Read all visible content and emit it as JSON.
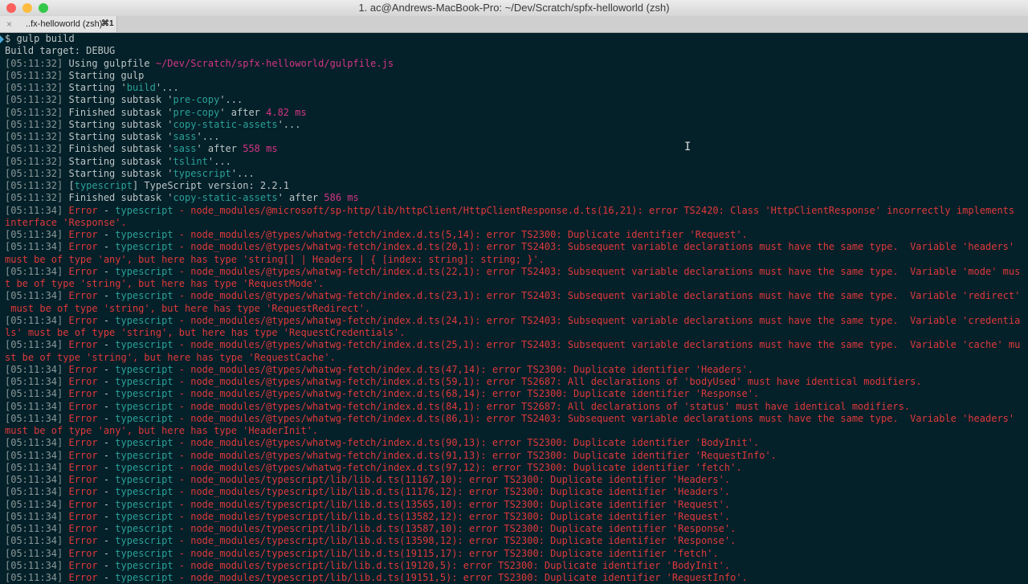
{
  "window": {
    "title": "1. ac@Andrews-MacBook-Pro: ~/Dev/Scratch/spfx-helloworld (zsh)",
    "colors": {
      "close": "#fc605c",
      "minimize": "#fdbc40",
      "zoom": "#34c84a"
    }
  },
  "tab": {
    "label": "..fx-helloworld (zsh)",
    "shortcut": "⌘1",
    "close_icon": "×"
  },
  "cursor_glyph": "I",
  "lines": [
    [
      [
        "tx",
        "$ gulp build"
      ]
    ],
    [
      [
        "tx",
        "Build target: DEBUG"
      ]
    ],
    [
      [
        "ts",
        "[05:11:32] "
      ],
      [
        "tx",
        "Using gulpfile "
      ],
      [
        "m",
        "~/Dev/Scratch/spfx-helloworld/gulpfile.js"
      ]
    ],
    [
      [
        "ts",
        "[05:11:32] "
      ],
      [
        "tx",
        "Starting gulp"
      ]
    ],
    [
      [
        "ts",
        "[05:11:32] "
      ],
      [
        "tx",
        "Starting '"
      ],
      [
        "q",
        "build"
      ],
      [
        "tx",
        "'..."
      ]
    ],
    [
      [
        "ts",
        "[05:11:32] "
      ],
      [
        "tx",
        "Starting subtask '"
      ],
      [
        "q",
        "pre-copy"
      ],
      [
        "tx",
        "'..."
      ]
    ],
    [
      [
        "ts",
        "[05:11:32] "
      ],
      [
        "tx",
        "Finished subtask '"
      ],
      [
        "q",
        "pre-copy"
      ],
      [
        "tx",
        "' after "
      ],
      [
        "m",
        "4.82 ms"
      ]
    ],
    [
      [
        "ts",
        "[05:11:32] "
      ],
      [
        "tx",
        "Starting subtask '"
      ],
      [
        "q",
        "copy-static-assets"
      ],
      [
        "tx",
        "'..."
      ]
    ],
    [
      [
        "ts",
        "[05:11:32] "
      ],
      [
        "tx",
        "Starting subtask '"
      ],
      [
        "q",
        "sass"
      ],
      [
        "tx",
        "'..."
      ]
    ],
    [
      [
        "ts",
        "[05:11:32] "
      ],
      [
        "tx",
        "Finished subtask '"
      ],
      [
        "q",
        "sass"
      ],
      [
        "tx",
        "' after "
      ],
      [
        "m",
        "558 ms"
      ]
    ],
    [
      [
        "ts",
        "[05:11:32] "
      ],
      [
        "tx",
        "Starting subtask '"
      ],
      [
        "q",
        "tslint"
      ],
      [
        "tx",
        "'..."
      ]
    ],
    [
      [
        "ts",
        "[05:11:32] "
      ],
      [
        "tx",
        "Starting subtask '"
      ],
      [
        "q",
        "typescript"
      ],
      [
        "tx",
        "'..."
      ]
    ],
    [
      [
        "ts",
        "[05:11:32] "
      ],
      [
        "tx",
        "["
      ],
      [
        "q",
        "typescript"
      ],
      [
        "tx",
        "] TypeScript version: 2.2.1"
      ]
    ],
    [
      [
        "ts",
        "[05:11:32] "
      ],
      [
        "tx",
        "Finished subtask '"
      ],
      [
        "q",
        "copy-static-assets"
      ],
      [
        "tx",
        "' after "
      ],
      [
        "m",
        "586 ms"
      ]
    ],
    [
      [
        "ts",
        "[05:11:34] "
      ],
      [
        "r",
        "Error"
      ],
      [
        "tx",
        " - "
      ],
      [
        "c",
        "typescript"
      ],
      [
        "r",
        " - node_modules/@microsoft/sp-http/lib/httpClient/HttpClientResponse.d.ts(16,21): error TS2420: Class 'HttpClientResponse' incorrectly implements"
      ]
    ],
    [
      [
        "r",
        "interface 'Response'."
      ]
    ],
    [
      [
        "ts",
        "[05:11:34] "
      ],
      [
        "r",
        "Error"
      ],
      [
        "tx",
        " - "
      ],
      [
        "c",
        "typescript"
      ],
      [
        "r",
        " - node_modules/@types/whatwg-fetch/index.d.ts(5,14): error TS2300: Duplicate identifier 'Request'."
      ]
    ],
    [
      [
        "ts",
        "[05:11:34] "
      ],
      [
        "r",
        "Error"
      ],
      [
        "tx",
        " - "
      ],
      [
        "c",
        "typescript"
      ],
      [
        "r",
        " - node_modules/@types/whatwg-fetch/index.d.ts(20,1): error TS2403: Subsequent variable declarations must have the same type.  Variable 'headers'"
      ]
    ],
    [
      [
        "r",
        "must be of type 'any', but here has type 'string[] | Headers | { [index: string]: string; }'."
      ]
    ],
    [
      [
        "ts",
        "[05:11:34] "
      ],
      [
        "r",
        "Error"
      ],
      [
        "tx",
        " - "
      ],
      [
        "c",
        "typescript"
      ],
      [
        "r",
        " - node_modules/@types/whatwg-fetch/index.d.ts(22,1): error TS2403: Subsequent variable declarations must have the same type.  Variable 'mode' mus"
      ]
    ],
    [
      [
        "r",
        "t be of type 'string', but here has type 'RequestMode'."
      ]
    ],
    [
      [
        "ts",
        "[05:11:34] "
      ],
      [
        "r",
        "Error"
      ],
      [
        "tx",
        " - "
      ],
      [
        "c",
        "typescript"
      ],
      [
        "r",
        " - node_modules/@types/whatwg-fetch/index.d.ts(23,1): error TS2403: Subsequent variable declarations must have the same type.  Variable 'redirect'"
      ]
    ],
    [
      [
        "r",
        " must be of type 'string', but here has type 'RequestRedirect'."
      ]
    ],
    [
      [
        "ts",
        "[05:11:34] "
      ],
      [
        "r",
        "Error"
      ],
      [
        "tx",
        " - "
      ],
      [
        "c",
        "typescript"
      ],
      [
        "r",
        " - node_modules/@types/whatwg-fetch/index.d.ts(24,1): error TS2403: Subsequent variable declarations must have the same type.  Variable 'credentia"
      ]
    ],
    [
      [
        "r",
        "ls' must be of type 'string', but here has type 'RequestCredentials'."
      ]
    ],
    [
      [
        "ts",
        "[05:11:34] "
      ],
      [
        "r",
        "Error"
      ],
      [
        "tx",
        " - "
      ],
      [
        "c",
        "typescript"
      ],
      [
        "r",
        " - node_modules/@types/whatwg-fetch/index.d.ts(25,1): error TS2403: Subsequent variable declarations must have the same type.  Variable 'cache' mu"
      ]
    ],
    [
      [
        "r",
        "st be of type 'string', but here has type 'RequestCache'."
      ]
    ],
    [
      [
        "ts",
        "[05:11:34] "
      ],
      [
        "r",
        "Error"
      ],
      [
        "tx",
        " - "
      ],
      [
        "c",
        "typescript"
      ],
      [
        "r",
        " - node_modules/@types/whatwg-fetch/index.d.ts(47,14): error TS2300: Duplicate identifier 'Headers'."
      ]
    ],
    [
      [
        "ts",
        "[05:11:34] "
      ],
      [
        "r",
        "Error"
      ],
      [
        "tx",
        " - "
      ],
      [
        "c",
        "typescript"
      ],
      [
        "r",
        " - node_modules/@types/whatwg-fetch/index.d.ts(59,1): error TS2687: All declarations of 'bodyUsed' must have identical modifiers."
      ]
    ],
    [
      [
        "ts",
        "[05:11:34] "
      ],
      [
        "r",
        "Error"
      ],
      [
        "tx",
        " - "
      ],
      [
        "c",
        "typescript"
      ],
      [
        "r",
        " - node_modules/@types/whatwg-fetch/index.d.ts(68,14): error TS2300: Duplicate identifier 'Response'."
      ]
    ],
    [
      [
        "ts",
        "[05:11:34] "
      ],
      [
        "r",
        "Error"
      ],
      [
        "tx",
        " - "
      ],
      [
        "c",
        "typescript"
      ],
      [
        "r",
        " - node_modules/@types/whatwg-fetch/index.d.ts(84,1): error TS2687: All declarations of 'status' must have identical modifiers."
      ]
    ],
    [
      [
        "ts",
        "[05:11:34] "
      ],
      [
        "r",
        "Error"
      ],
      [
        "tx",
        " - "
      ],
      [
        "c",
        "typescript"
      ],
      [
        "r",
        " - node_modules/@types/whatwg-fetch/index.d.ts(86,1): error TS2403: Subsequent variable declarations must have the same type.  Variable 'headers'"
      ]
    ],
    [
      [
        "r",
        "must be of type 'any', but here has type 'HeaderInit'."
      ]
    ],
    [
      [
        "ts",
        "[05:11:34] "
      ],
      [
        "r",
        "Error"
      ],
      [
        "tx",
        " - "
      ],
      [
        "c",
        "typescript"
      ],
      [
        "r",
        " - node_modules/@types/whatwg-fetch/index.d.ts(90,13): error TS2300: Duplicate identifier 'BodyInit'."
      ]
    ],
    [
      [
        "ts",
        "[05:11:34] "
      ],
      [
        "r",
        "Error"
      ],
      [
        "tx",
        " - "
      ],
      [
        "c",
        "typescript"
      ],
      [
        "r",
        " - node_modules/@types/whatwg-fetch/index.d.ts(91,13): error TS2300: Duplicate identifier 'RequestInfo'."
      ]
    ],
    [
      [
        "ts",
        "[05:11:34] "
      ],
      [
        "r",
        "Error"
      ],
      [
        "tx",
        " - "
      ],
      [
        "c",
        "typescript"
      ],
      [
        "r",
        " - node_modules/@types/whatwg-fetch/index.d.ts(97,12): error TS2300: Duplicate identifier 'fetch'."
      ]
    ],
    [
      [
        "ts",
        "[05:11:34] "
      ],
      [
        "r",
        "Error"
      ],
      [
        "tx",
        " - "
      ],
      [
        "c",
        "typescript"
      ],
      [
        "r",
        " - node_modules/typescript/lib/lib.d.ts(11167,10): error TS2300: Duplicate identifier 'Headers'."
      ]
    ],
    [
      [
        "ts",
        "[05:11:34] "
      ],
      [
        "r",
        "Error"
      ],
      [
        "tx",
        " - "
      ],
      [
        "c",
        "typescript"
      ],
      [
        "r",
        " - node_modules/typescript/lib/lib.d.ts(11176,12): error TS2300: Duplicate identifier 'Headers'."
      ]
    ],
    [
      [
        "ts",
        "[05:11:34] "
      ],
      [
        "r",
        "Error"
      ],
      [
        "tx",
        " - "
      ],
      [
        "c",
        "typescript"
      ],
      [
        "r",
        " - node_modules/typescript/lib/lib.d.ts(13565,10): error TS2300: Duplicate identifier 'Request'."
      ]
    ],
    [
      [
        "ts",
        "[05:11:34] "
      ],
      [
        "r",
        "Error"
      ],
      [
        "tx",
        " - "
      ],
      [
        "c",
        "typescript"
      ],
      [
        "r",
        " - node_modules/typescript/lib/lib.d.ts(13582,12): error TS2300: Duplicate identifier 'Request'."
      ]
    ],
    [
      [
        "ts",
        "[05:11:34] "
      ],
      [
        "r",
        "Error"
      ],
      [
        "tx",
        " - "
      ],
      [
        "c",
        "typescript"
      ],
      [
        "r",
        " - node_modules/typescript/lib/lib.d.ts(13587,10): error TS2300: Duplicate identifier 'Response'."
      ]
    ],
    [
      [
        "ts",
        "[05:11:34] "
      ],
      [
        "r",
        "Error"
      ],
      [
        "tx",
        " - "
      ],
      [
        "c",
        "typescript"
      ],
      [
        "r",
        " - node_modules/typescript/lib/lib.d.ts(13598,12): error TS2300: Duplicate identifier 'Response'."
      ]
    ],
    [
      [
        "ts",
        "[05:11:34] "
      ],
      [
        "r",
        "Error"
      ],
      [
        "tx",
        " - "
      ],
      [
        "c",
        "typescript"
      ],
      [
        "r",
        " - node_modules/typescript/lib/lib.d.ts(19115,17): error TS2300: Duplicate identifier 'fetch'."
      ]
    ],
    [
      [
        "ts",
        "[05:11:34] "
      ],
      [
        "r",
        "Error"
      ],
      [
        "tx",
        " - "
      ],
      [
        "c",
        "typescript"
      ],
      [
        "r",
        " - node_modules/typescript/lib/lib.d.ts(19120,5): error TS2300: Duplicate identifier 'BodyInit'."
      ]
    ],
    [
      [
        "ts",
        "[05:11:34] "
      ],
      [
        "r",
        "Error"
      ],
      [
        "tx",
        " - "
      ],
      [
        "c",
        "typescript"
      ],
      [
        "r",
        " - node_modules/typescript/lib/lib.d.ts(19151,5): error TS2300: Duplicate identifier 'RequestInfo'."
      ]
    ]
  ]
}
